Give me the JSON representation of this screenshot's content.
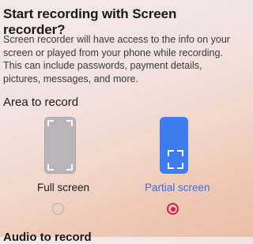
{
  "dialog": {
    "title": "Start recording with Screen recorder?",
    "description": "Screen recorder will have access to the info on your screen or played from your phone while recording. This can include passwords, payment details, pictures, messages, and more."
  },
  "area": {
    "label": "Area to record",
    "options": [
      {
        "label": "Full screen",
        "selected": false
      },
      {
        "label": "Partial screen",
        "selected": true
      }
    ]
  },
  "audio": {
    "label": "Audio to record"
  },
  "colors": {
    "accent": "#3a6fe0",
    "radio_selected": "#d0234b",
    "phone_gray": "#b8b6b9",
    "phone_blue": "#3e7df0"
  }
}
